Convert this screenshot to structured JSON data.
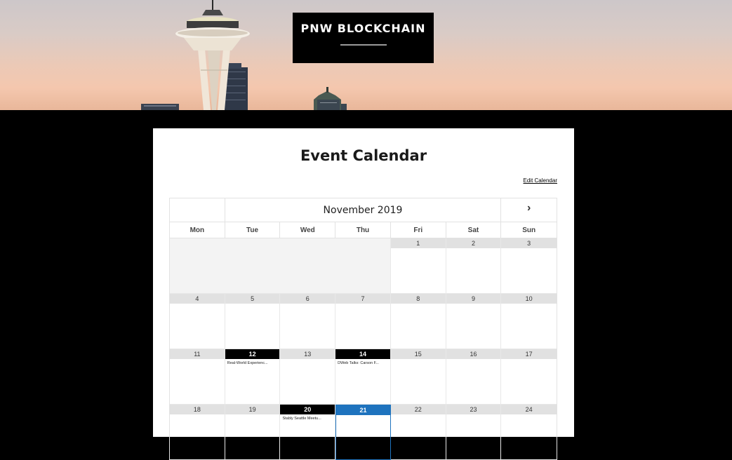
{
  "header": {
    "site_title": "PNW BLOCKCHAIN"
  },
  "main": {
    "page_title": "Event Calendar",
    "edit_link": "Edit Calendar"
  },
  "calendar": {
    "month_label": "November 2019",
    "next_icon": "›",
    "weekdays": [
      "Mon",
      "Tue",
      "Wed",
      "Thu",
      "Fri",
      "Sat",
      "Sun"
    ],
    "weeks": [
      [
        {
          "day": "",
          "empty": true
        },
        {
          "day": "",
          "empty": true
        },
        {
          "day": "",
          "empty": true
        },
        {
          "day": "",
          "empty": true
        },
        {
          "day": "1"
        },
        {
          "day": "2"
        },
        {
          "day": "3"
        }
      ],
      [
        {
          "day": "4"
        },
        {
          "day": "5"
        },
        {
          "day": "6"
        },
        {
          "day": "7"
        },
        {
          "day": "8"
        },
        {
          "day": "9"
        },
        {
          "day": "10"
        }
      ],
      [
        {
          "day": "11"
        },
        {
          "day": "12",
          "event": "Real-World Experienc..."
        },
        {
          "day": "13"
        },
        {
          "day": "14",
          "event": "DWeb Talks: Carson F..."
        },
        {
          "day": "15"
        },
        {
          "day": "16"
        },
        {
          "day": "17"
        }
      ],
      [
        {
          "day": "18"
        },
        {
          "day": "19"
        },
        {
          "day": "20",
          "event": "Stably Seattle Meetu..."
        },
        {
          "day": "21",
          "today": true
        },
        {
          "day": "22"
        },
        {
          "day": "23"
        },
        {
          "day": "24"
        }
      ]
    ]
  },
  "colors": {
    "today": "#1e73be",
    "event_header": "#000000",
    "day_header": "#e1e1e1"
  }
}
